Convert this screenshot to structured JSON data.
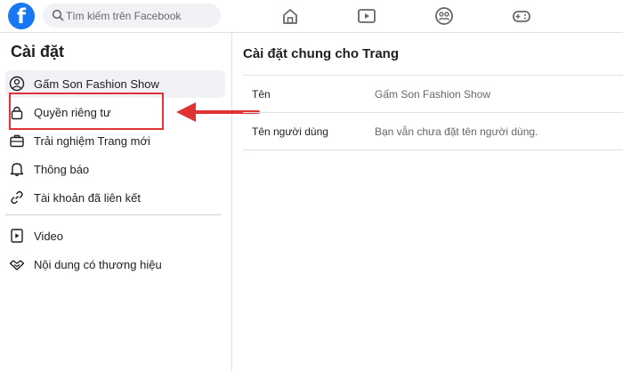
{
  "search": {
    "placeholder": "Tìm kiếm trên Facebook"
  },
  "logo": {
    "letter": "f"
  },
  "nav": [
    "home-icon",
    "watch-icon",
    "groups-icon",
    "gaming-icon"
  ],
  "sidebar": {
    "title": "Cài đặt",
    "items": [
      {
        "label": "Gấm Son Fashion Show",
        "icon": "profile-icon",
        "active": true
      },
      {
        "label": "Quyền riêng tư",
        "icon": "lock-icon"
      },
      {
        "label": "Trải nghiệm Trang mới",
        "icon": "briefcase-icon"
      },
      {
        "label": "Thông báo",
        "icon": "bell-icon"
      },
      {
        "label": "Tài khoản đã liên kết",
        "icon": "link-icon"
      },
      {
        "label": "Video",
        "icon": "video-icon"
      },
      {
        "label": "Nội dung có thương hiệu",
        "icon": "handshake-icon"
      }
    ]
  },
  "main": {
    "title": "Cài đặt chung cho Trang",
    "rows": [
      {
        "label": "Tên",
        "value": "Gấm Son Fashion Show"
      },
      {
        "label": "Tên người dùng",
        "value": "Bạn vẫn chưa đặt tên người dùng."
      }
    ]
  },
  "colors": {
    "brand": "#1877f2",
    "annotation": "#e03434"
  }
}
